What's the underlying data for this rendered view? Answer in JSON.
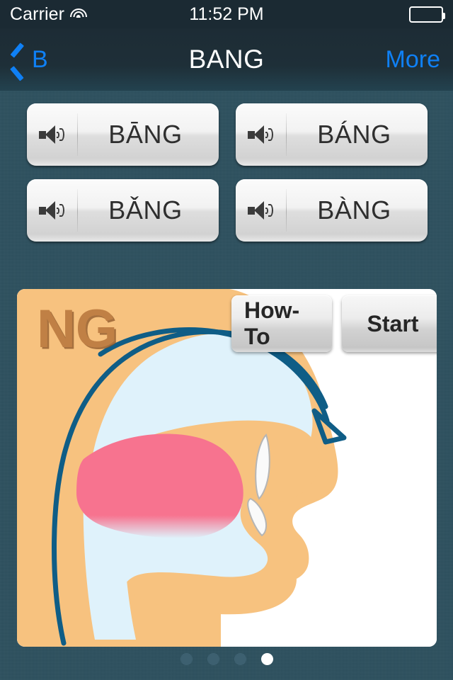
{
  "status_bar": {
    "carrier": "Carrier",
    "wifi_icon": "wifi-icon",
    "time": "11:52 PM",
    "battery_icon": "battery-full-icon"
  },
  "nav_bar": {
    "back_icon": "chevron-left-icon",
    "back_label": "B",
    "title": "BANG",
    "more_label": "More"
  },
  "tone_buttons": [
    {
      "speaker_icon": "speaker-icon",
      "label": "BĀNG",
      "tone": 1
    },
    {
      "speaker_icon": "speaker-icon",
      "label": "BÁNG",
      "tone": 2
    },
    {
      "speaker_icon": "speaker-icon",
      "label": "BǍNG",
      "tone": 3
    },
    {
      "speaker_icon": "speaker-icon",
      "label": "BÀNG",
      "tone": 4
    }
  ],
  "diagram": {
    "sound_label": "NG",
    "how_to_label": "How-To",
    "start_label": "Start",
    "colors": {
      "skin": "#f7c27f",
      "oral_cavity": "#dff2fb",
      "tongue": "#f7738f",
      "teeth": "#fafafa",
      "airflow_arrow": "#0f5d86",
      "label_text": "#c08044",
      "card_background": "#ffffff"
    }
  },
  "page_indicator": {
    "total": 4,
    "active_index": 3
  },
  "theme": {
    "background": "#2b4f5e",
    "navbar": "#1d2c35",
    "accent_blue": "#0f80f5",
    "status_bar": "#1b2a33"
  }
}
